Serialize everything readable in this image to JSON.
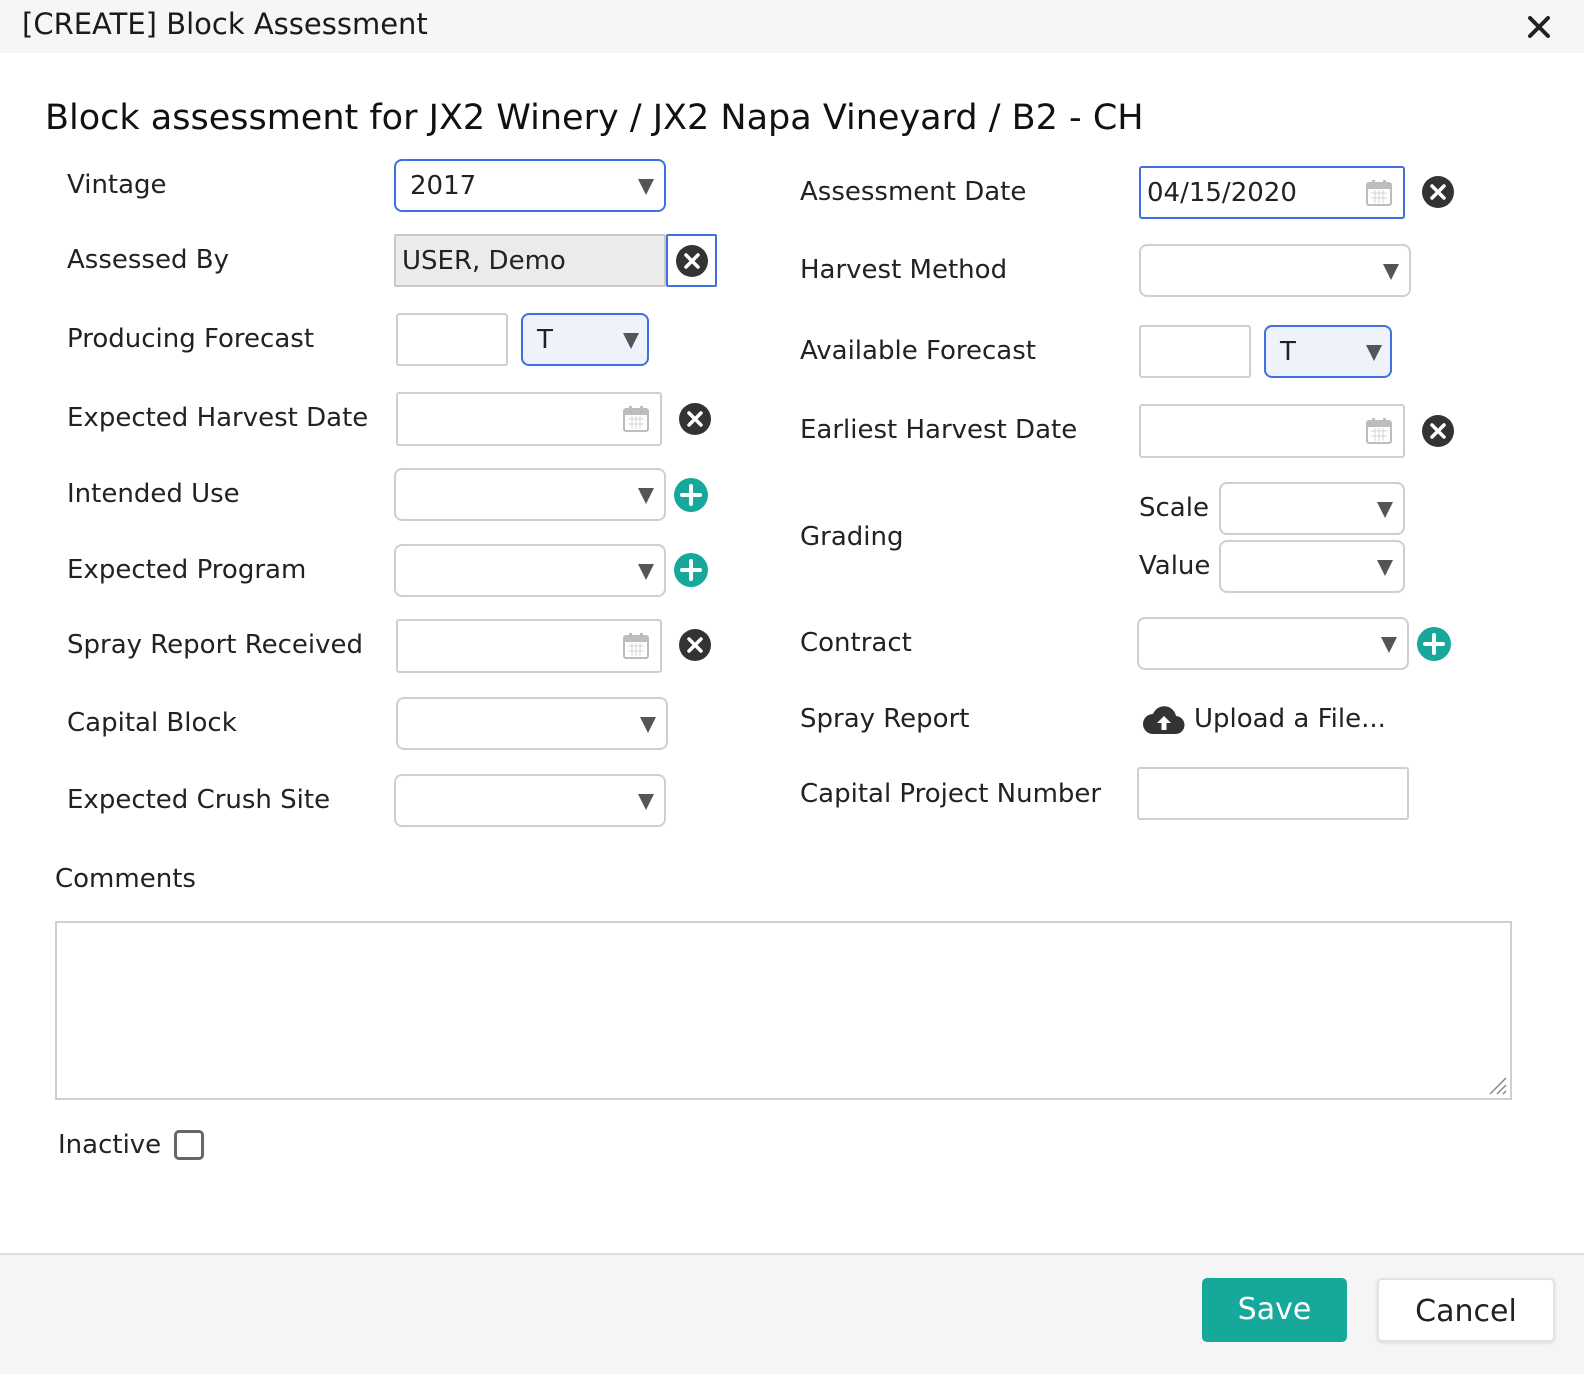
{
  "dialog": {
    "title": "[CREATE] Block Assessment"
  },
  "heading": "Block assessment for JX2 Winery / JX2 Napa Vineyard / B2 - CH",
  "left": {
    "vintage": {
      "label": "Vintage",
      "value": "2017"
    },
    "assessed_by": {
      "label": "Assessed By",
      "value": "USER, Demo"
    },
    "producing_forecast": {
      "label": "Producing Forecast",
      "value": "",
      "unit": "T"
    },
    "expected_harvest_date": {
      "label": "Expected Harvest Date",
      "value": ""
    },
    "intended_use": {
      "label": "Intended Use",
      "value": ""
    },
    "expected_program": {
      "label": "Expected Program",
      "value": ""
    },
    "spray_report_received": {
      "label": "Spray Report Received",
      "value": ""
    },
    "capital_block": {
      "label": "Capital Block",
      "value": ""
    },
    "expected_crush_site": {
      "label": "Expected Crush Site",
      "value": ""
    }
  },
  "right": {
    "assessment_date": {
      "label": "Assessment Date",
      "value": "04/15/2020"
    },
    "harvest_method": {
      "label": "Harvest Method",
      "value": ""
    },
    "available_forecast": {
      "label": "Available Forecast",
      "value": "",
      "unit": "T"
    },
    "earliest_harvest_date": {
      "label": "Earliest Harvest Date",
      "value": ""
    },
    "grading": {
      "label": "Grading",
      "scale_label": "Scale",
      "value_label": "Value",
      "scale": "",
      "value": ""
    },
    "contract": {
      "label": "Contract",
      "value": ""
    },
    "spray_report": {
      "label": "Spray Report",
      "upload_label": "Upload a File..."
    },
    "capital_project_number": {
      "label": "Capital Project Number",
      "value": ""
    }
  },
  "comments": {
    "label": "Comments",
    "value": ""
  },
  "inactive": {
    "label": "Inactive",
    "checked": false
  },
  "footer": {
    "save_label": "Save",
    "cancel_label": "Cancel"
  },
  "colors": {
    "accent": "#16a89a",
    "focus_border": "#3f6fe0",
    "clear_icon": "#333333",
    "add_icon": "#16a89a"
  }
}
